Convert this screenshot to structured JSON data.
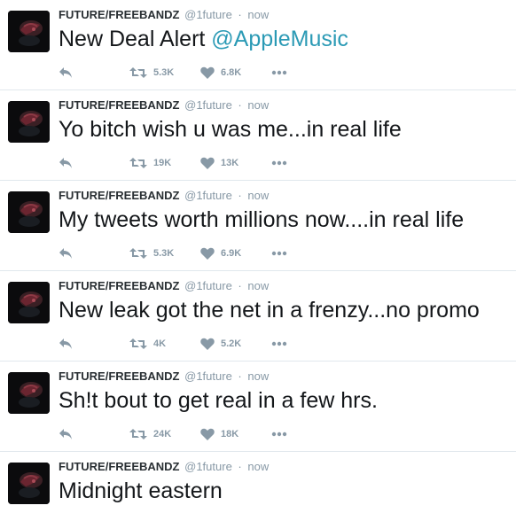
{
  "colors": {
    "mention": "#2b9ab5",
    "meta": "#8899a6",
    "divider": "#e1e8ed"
  },
  "icons": {
    "reply": "reply-icon",
    "retweet": "retweet-icon",
    "like": "heart-icon",
    "more": "more-dots-icon"
  },
  "tweets": [
    {
      "name": "FUTURE/FREEBANDZ",
      "handle": "@1future",
      "time": "now",
      "text": "New Deal Alert ",
      "mention": "@AppleMusic",
      "retweets": "5.3K",
      "likes": "6.8K"
    },
    {
      "name": "FUTURE/FREEBANDZ",
      "handle": "@1future",
      "time": "now",
      "text": "Yo bitch wish u was me...in real life",
      "mention": "",
      "retweets": "19K",
      "likes": "13K"
    },
    {
      "name": "FUTURE/FREEBANDZ",
      "handle": "@1future",
      "time": "now",
      "text": "My tweets worth millions now....in real life",
      "mention": "",
      "retweets": "5.3K",
      "likes": "6.9K"
    },
    {
      "name": "FUTURE/FREEBANDZ",
      "handle": "@1future",
      "time": "now",
      "text": "New leak got the net in a frenzy...no promo",
      "mention": "",
      "retweets": "4K",
      "likes": "5.2K"
    },
    {
      "name": "FUTURE/FREEBANDZ",
      "handle": "@1future",
      "time": "now",
      "text": "Sh!t bout to get real in a few hrs.",
      "mention": "",
      "retweets": "24K",
      "likes": "18K"
    },
    {
      "name": "FUTURE/FREEBANDZ",
      "handle": "@1future",
      "time": "now",
      "text": "Midnight eastern",
      "mention": "",
      "retweets": "",
      "likes": ""
    }
  ]
}
